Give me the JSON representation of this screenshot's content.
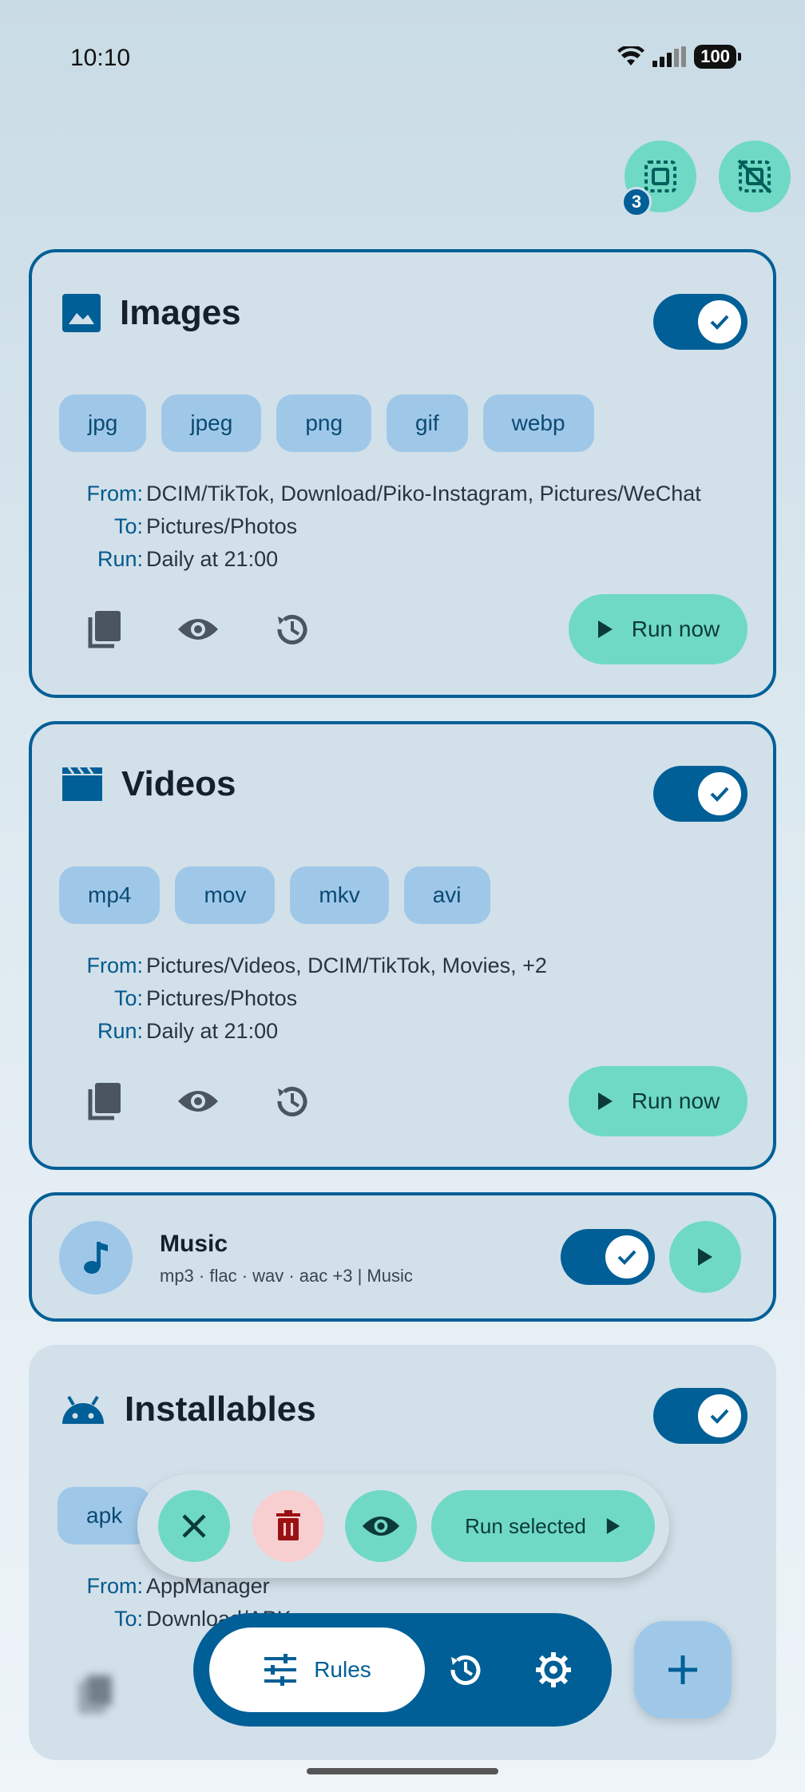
{
  "status_bar": {
    "time": "10:10",
    "battery": "100"
  },
  "top_actions": {
    "selected_count": "3"
  },
  "rules": [
    {
      "title": "Images",
      "enabled": true,
      "extensions": [
        "jpg",
        "jpeg",
        "png",
        "gif",
        "webp"
      ],
      "from_label": "From:",
      "from": "DCIM/TikTok, Download/Piko-Instagram, Pictures/WeChat",
      "to_label": "To:",
      "to": "Pictures/Photos",
      "run_label": "Run:",
      "run": "Daily at 21:00",
      "run_now_label": "Run now"
    },
    {
      "title": "Videos",
      "enabled": true,
      "extensions": [
        "mp4",
        "mov",
        "mkv",
        "avi"
      ],
      "from_label": "From:",
      "from": "Pictures/Videos, DCIM/TikTok, Movies, +2",
      "to_label": "To:",
      "to": "Pictures/Photos",
      "run_label": "Run:",
      "run": "Daily at 21:00",
      "run_now_label": "Run now"
    },
    {
      "title": "Music",
      "enabled": true,
      "subtitle": "mp3 · flac · wav · aac +3  |  Music"
    },
    {
      "title": "Installables",
      "enabled": true,
      "extensions": [
        "apk"
      ],
      "from_label": "From:",
      "from": "AppManager",
      "to_label": "To:",
      "to": "Download/APK"
    }
  ],
  "selection_bar": {
    "run_selected_label": "Run selected"
  },
  "bottom_nav": {
    "rules_label": "Rules"
  },
  "colors": {
    "primary": "#005f96",
    "accent": "#6fd9c6",
    "chip": "#9fc8e8",
    "card": "#d2e0ea",
    "delete": "#f8cfd0"
  }
}
